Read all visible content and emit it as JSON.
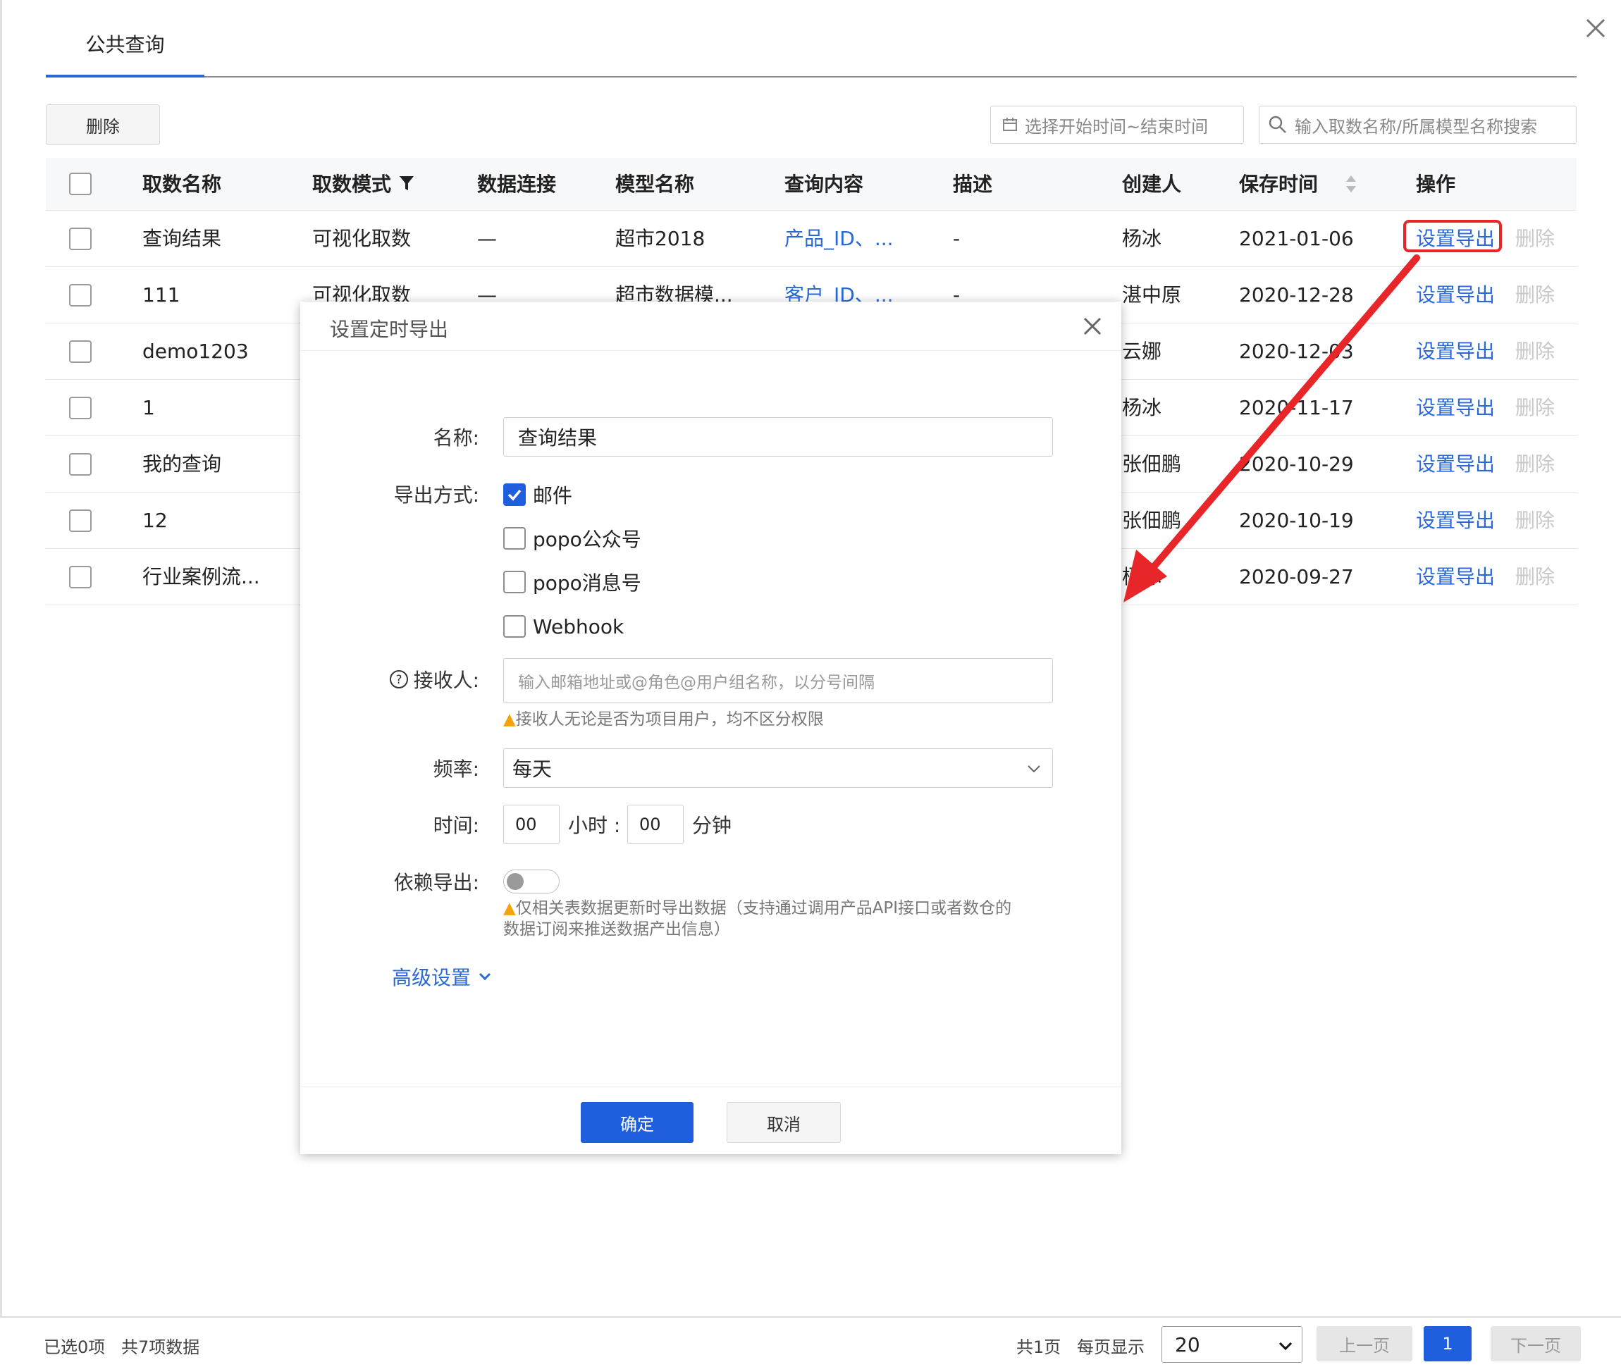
{
  "tab": {
    "label": "公共查询"
  },
  "toolbar": {
    "delete_label": "删除",
    "date_placeholder": "选择开始时间~结束时间",
    "search_placeholder": "输入取数名称/所属模型名称搜索"
  },
  "table": {
    "headers": {
      "name": "取数名称",
      "mode": "取数模式",
      "connection": "数据连接",
      "model": "模型名称",
      "query": "查询内容",
      "desc": "描述",
      "creator": "创建人",
      "saved": "保存时间",
      "ops": "操作"
    },
    "rows": [
      {
        "name": "查询结果",
        "mode": "可视化取数",
        "connection": "—",
        "model": "超市2018",
        "query": "产品_ID、...",
        "desc": "-",
        "creator": "杨冰",
        "saved": "2021-01-06",
        "export": "设置导出",
        "delete": "删除"
      },
      {
        "name": "111",
        "mode": "可视化取数",
        "connection": "—",
        "model": "超市数据模...",
        "query": "客户_ID、...",
        "desc": "-",
        "creator": "湛中原",
        "saved": "2020-12-28",
        "export": "设置导出",
        "delete": "删除"
      },
      {
        "name": "demo1203",
        "mode": "",
        "connection": "",
        "model": "",
        "query": "",
        "desc": "",
        "creator": "云娜",
        "saved": "2020-12-03",
        "export": "设置导出",
        "delete": "删除"
      },
      {
        "name": "1",
        "mode": "",
        "connection": "",
        "model": "",
        "query": "",
        "desc": "",
        "creator": "杨冰",
        "saved": "2020-11-17",
        "export": "设置导出",
        "delete": "删除"
      },
      {
        "name": "我的查询",
        "mode": "",
        "connection": "",
        "model": "",
        "query": "",
        "desc": "",
        "creator": "张佃鹏",
        "saved": "2020-10-29",
        "export": "设置导出",
        "delete": "删除"
      },
      {
        "name": "12",
        "mode": "",
        "connection": "",
        "model": "",
        "query": "",
        "desc": "",
        "creator": "张佃鹏",
        "saved": "2020-10-19",
        "export": "设置导出",
        "delete": "删除"
      },
      {
        "name": "行业案例流...",
        "mode": "",
        "connection": "",
        "model": "",
        "query": "",
        "desc": "",
        "creator": "杨冰",
        "saved": "2020-09-27",
        "export": "设置导出",
        "delete": "删除"
      }
    ]
  },
  "modal": {
    "title": "设置定时导出",
    "name_label": "名称:",
    "name_value": "查询结果",
    "method_label": "导出方式:",
    "methods": [
      {
        "label": "邮件",
        "checked": true
      },
      {
        "label": "popo公众号",
        "checked": false
      },
      {
        "label": "popo消息号",
        "checked": false
      },
      {
        "label": "Webhook",
        "checked": false
      }
    ],
    "recipient_label": "接收人:",
    "recipient_placeholder": "输入邮箱地址或@角色@用户组名称，以分号间隔",
    "recipient_hint": "接收人无论是否为项目用户，均不区分权限",
    "freq_label": "频率:",
    "freq_value": "每天",
    "time_label": "时间:",
    "hour_value": "00",
    "hour_unit": "小时 :",
    "minute_value": "00",
    "minute_unit": "分钟",
    "depend_label": "依赖导出:",
    "depend_on": false,
    "depend_hint_line1": "仅相关表数据更新时导出数据（支持通过调用产品API接口或者数仓的",
    "depend_hint_line2": "数据订阅来推送数据产出信息）",
    "advanced_label": "高级设置",
    "ok_label": "确定",
    "cancel_label": "取消"
  },
  "footer": {
    "selected_text": "已选0项",
    "total_text": "共7项数据",
    "pages_text": "共1页",
    "per_page_label": "每页显示",
    "per_page_value": "20",
    "prev_label": "上一页",
    "current_page": "1",
    "next_label": "下一页"
  },
  "colors": {
    "primary": "#1f5fde",
    "link": "#2a68d8",
    "annotation": "#e8262a",
    "warn": "#f5a30a"
  }
}
